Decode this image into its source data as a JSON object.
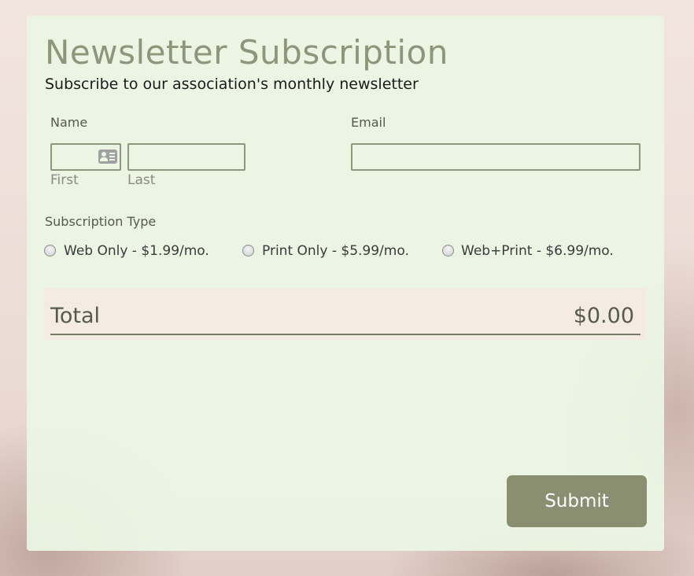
{
  "form": {
    "title": "Newsletter Subscription",
    "subtitle": "Subscribe to our association's monthly newsletter"
  },
  "name_field": {
    "label": "Name",
    "first_sublabel": "First",
    "last_sublabel": "Last",
    "first_value": "",
    "last_value": "",
    "icon": "contact-card-icon"
  },
  "email_field": {
    "label": "Email",
    "value": ""
  },
  "subscription": {
    "label": "Subscription Type",
    "options": [
      {
        "label": "Web Only - $1.99/mo.",
        "selected": false
      },
      {
        "label": "Print Only - $5.99/mo.",
        "selected": false
      },
      {
        "label": "Web+Print - $6.99/mo.",
        "selected": false
      }
    ]
  },
  "total": {
    "label": "Total",
    "value": "$0.00"
  },
  "submit_label": "Submit",
  "colors": {
    "accent": "#8f957a",
    "button": "#8a8f72",
    "card_background": "#ecf6e4",
    "total_background": "#f4ebe3"
  }
}
